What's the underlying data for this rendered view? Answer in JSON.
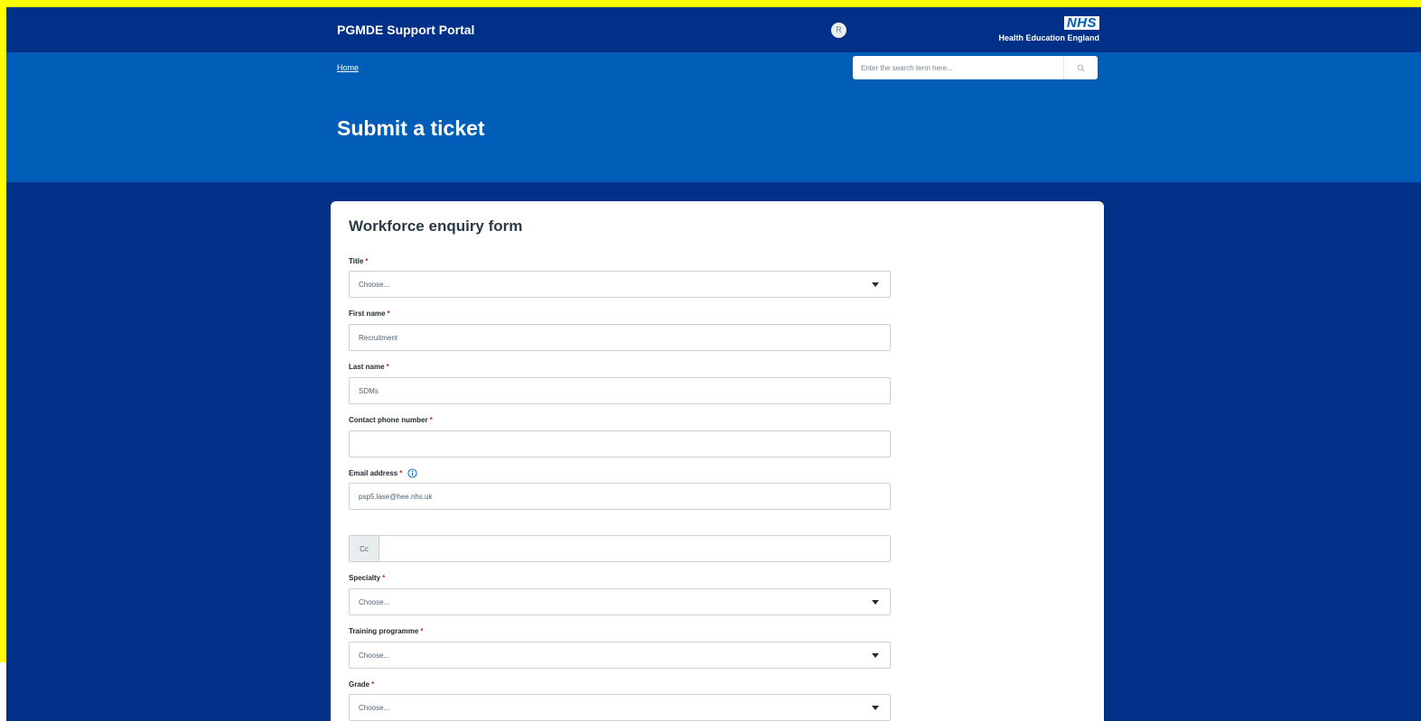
{
  "header": {
    "portal_name": "PGMDE Support Portal",
    "avatar_initial": "R",
    "logo": {
      "badge": "NHS",
      "subtitle": "Health Education England"
    }
  },
  "breadcrumb": {
    "home": "Home"
  },
  "search": {
    "placeholder": "Enter the search term here..."
  },
  "page": {
    "title": "Submit a ticket"
  },
  "form": {
    "title": "Workforce enquiry form",
    "required_marker": "*",
    "fields": {
      "title": {
        "label": "Title",
        "value": "Choose..."
      },
      "first_name": {
        "label": "First name",
        "value": "Recruitment"
      },
      "last_name": {
        "label": "Last name",
        "value": "SDMs"
      },
      "phone": {
        "label": "Contact phone number",
        "value": ""
      },
      "email": {
        "label": "Email address",
        "value": "psp5.lase@hee.nhs.uk"
      },
      "cc": {
        "addon": "Cc",
        "value": ""
      },
      "specialty": {
        "label": "Specialty",
        "value": "Choose..."
      },
      "training_programme": {
        "label": "Training programme",
        "value": "Choose..."
      },
      "grade": {
        "label": "Grade",
        "value": "Choose..."
      }
    }
  },
  "icons": {
    "search": "search-icon",
    "dropdown": "caret-down-icon",
    "info": "info-icon",
    "user": "avatar"
  },
  "colors": {
    "header_bg": "#003087",
    "hero_bg": "#005eb8",
    "highlight": "#ffff00",
    "required": "#d5281b",
    "info": "#005eb8"
  }
}
